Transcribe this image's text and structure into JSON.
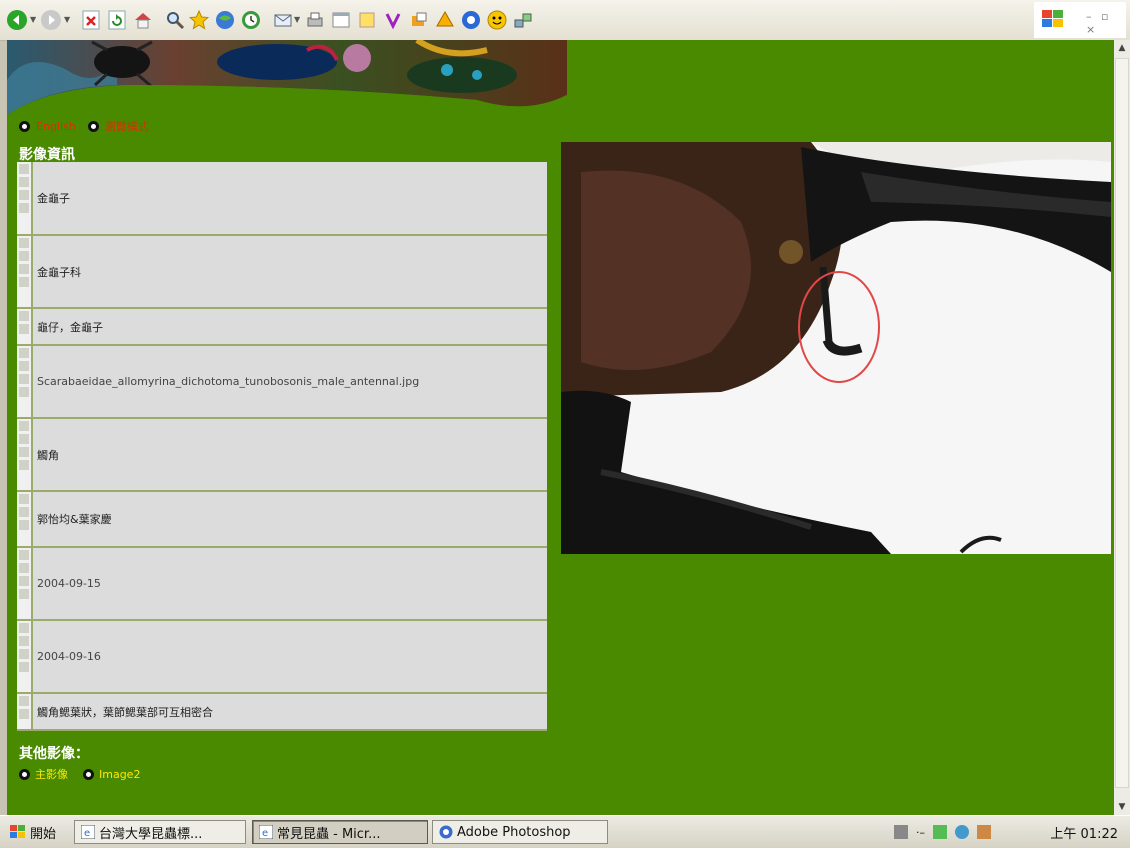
{
  "nav": {
    "link1": "English",
    "link2": "瀏覽模式"
  },
  "section_title": "影像資訊",
  "info_rows": [
    {
      "value": "金龜子"
    },
    {
      "value": "金龜子科"
    },
    {
      "value": "龜仔，金龜子"
    },
    {
      "value": "Scarabaeidae_allomyrina_dichotoma_tunobosonis_male_antennal.jpg"
    },
    {
      "value": "觸角"
    },
    {
      "value": "郭怡均&葉家慶"
    },
    {
      "value": "2004-09-15"
    },
    {
      "value": "2004-09-16"
    },
    {
      "value": "觸角鰓葉狀，葉節鰓葉部可互相密合"
    }
  ],
  "other_images": {
    "title": "其他影像：",
    "link1": "主影像",
    "link2": "Image2"
  },
  "taskbar": {
    "start_label": "開始",
    "tasks": [
      {
        "label": "台灣大學昆蟲標..."
      },
      {
        "label": "常見昆蟲 - Micr..."
      },
      {
        "label": "Adobe Photoshop"
      }
    ],
    "clock": "上午 01:22"
  },
  "colors": {
    "page_bg": "#4a8a00",
    "link_red": "#d83000",
    "link_yellow": "#ffe800",
    "table_bg": "#dcdcdc"
  }
}
